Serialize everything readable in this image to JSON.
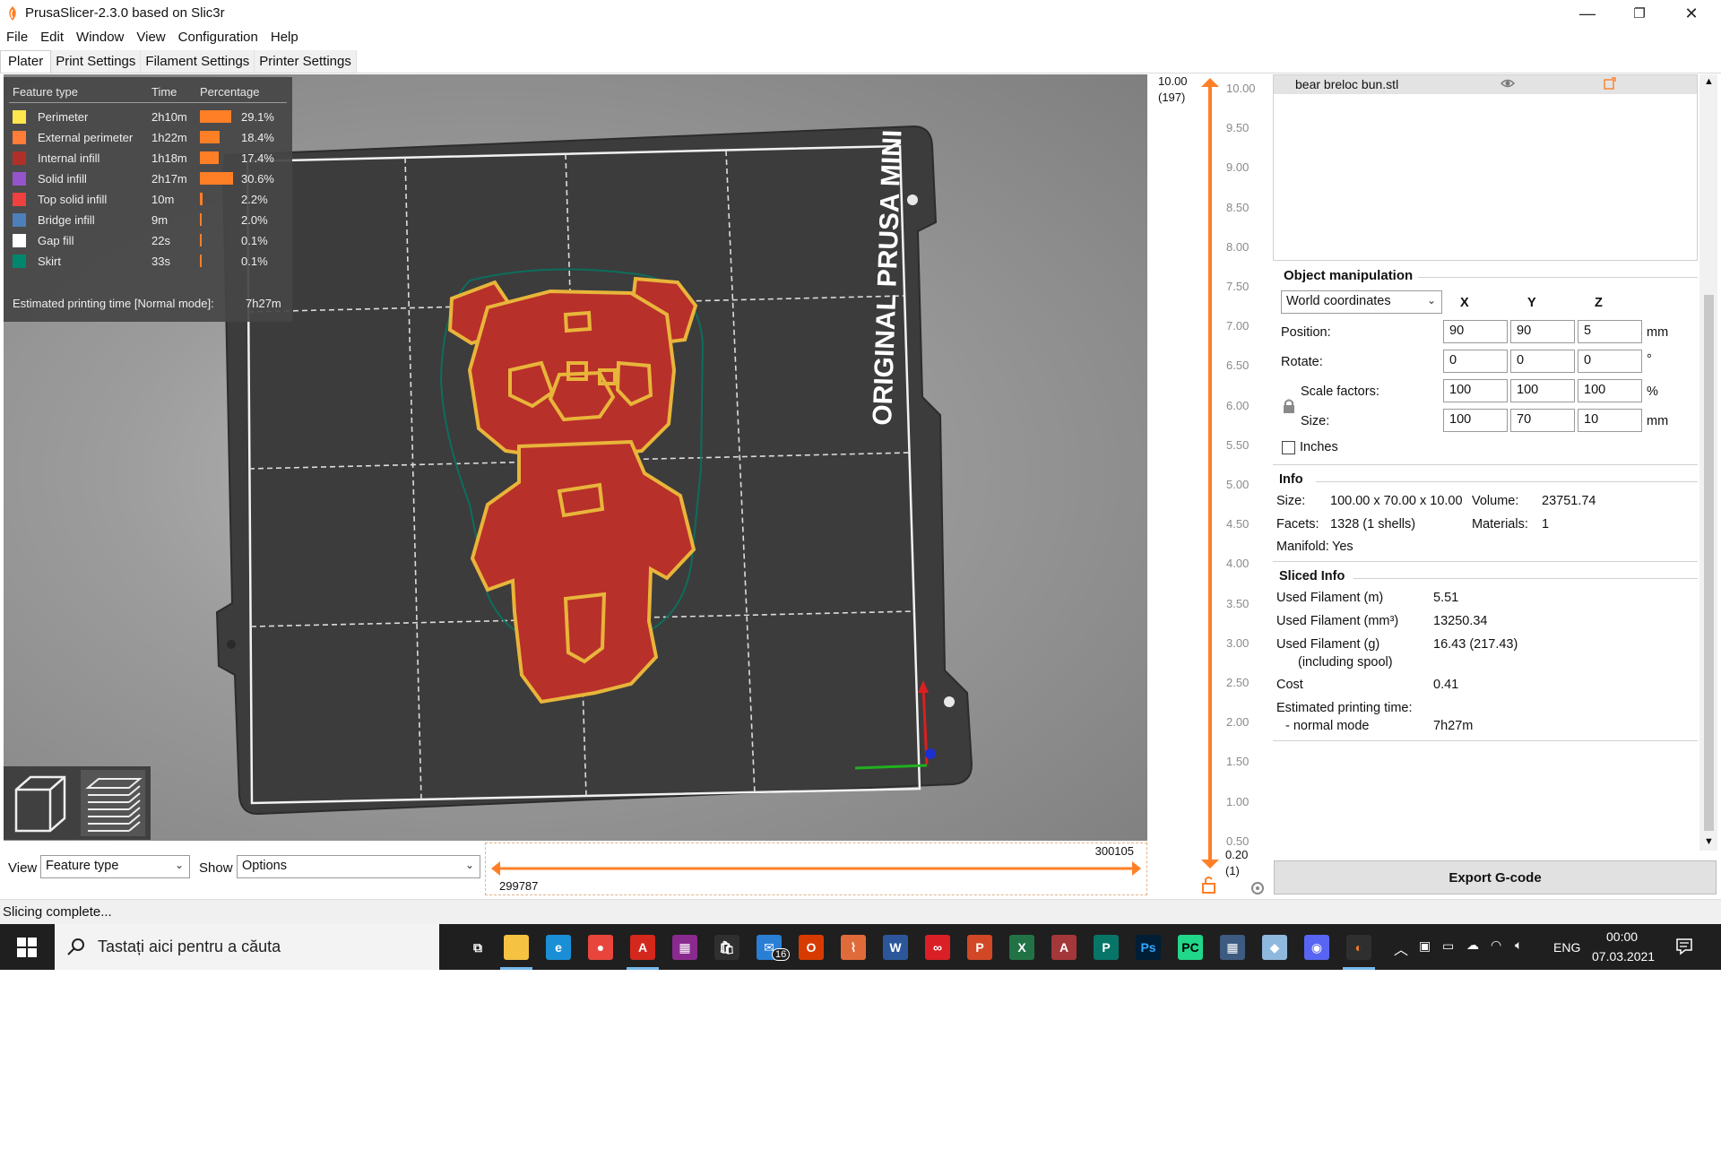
{
  "window": {
    "title": "PrusaSlicer-2.3.0 based on Slic3r",
    "minimize": "—",
    "maximize": "❐",
    "close": "✕"
  },
  "menu": [
    "File",
    "Edit",
    "Window",
    "View",
    "Configuration",
    "Help"
  ],
  "tabs": [
    "Plater",
    "Print Settings",
    "Filament Settings",
    "Printer Settings"
  ],
  "legend": {
    "headers": {
      "type": "Feature type",
      "time": "Time",
      "percentage": "Percentage"
    },
    "rows": [
      {
        "name": "Perimeter",
        "time": "2h10m",
        "pct": "29.1%",
        "value": 29.1,
        "color": "#ffe64d"
      },
      {
        "name": "External perimeter",
        "time": "1h22m",
        "pct": "18.4%",
        "value": 18.4,
        "color": "#ff7d38"
      },
      {
        "name": "Internal infill",
        "time": "1h18m",
        "pct": "17.4%",
        "value": 17.4,
        "color": "#b03029"
      },
      {
        "name": "Solid infill",
        "time": "2h17m",
        "pct": "30.6%",
        "value": 30.6,
        "color": "#9654cc"
      },
      {
        "name": "Top solid infill",
        "time": "10m",
        "pct": "2.2%",
        "value": 2.2,
        "color": "#f04040"
      },
      {
        "name": "Bridge infill",
        "time": "9m",
        "pct": "2.0%",
        "value": 2.0,
        "color": "#4d80ba"
      },
      {
        "name": "Gap fill",
        "time": "22s",
        "pct": "0.1%",
        "value": 0.1,
        "color": "#ffffff"
      },
      {
        "name": "Skirt",
        "time": "33s",
        "pct": "0.1%",
        "value": 0.1,
        "color": "#00876e"
      }
    ],
    "estimated_label": "Estimated printing time [Normal mode]:",
    "estimated_value": "7h27m"
  },
  "bed_label": "ORIGINAL PRUSA MINI",
  "vertical_slider": {
    "top_value": "10.00",
    "top_layer": "(197)",
    "bottom_value": "0.20",
    "bottom_layer": "(1)",
    "ticks": [
      "10.00",
      "9.50",
      "9.00",
      "8.50",
      "8.00",
      "7.50",
      "7.00",
      "6.50",
      "6.00",
      "5.50",
      "5.00",
      "4.50",
      "4.00",
      "3.50",
      "3.00",
      "2.50",
      "2.00",
      "1.50",
      "1.00",
      "0.50"
    ]
  },
  "horizontal_slider": {
    "right_value": "300105",
    "left_value": "299787"
  },
  "bottom": {
    "view_label": "View",
    "view_value": "Feature type",
    "show_label": "Show",
    "show_value": "Options"
  },
  "object_list": {
    "name": "bear breloc bun.stl"
  },
  "object_manipulation": {
    "title": "Object manipulation",
    "coords": "World coordinates",
    "axes": [
      "X",
      "Y",
      "Z"
    ],
    "position": {
      "label": "Position:",
      "values": [
        "90",
        "90",
        "5"
      ],
      "unit": "mm"
    },
    "rotate": {
      "label": "Rotate:",
      "values": [
        "0",
        "0",
        "0"
      ],
      "unit": "°"
    },
    "scale": {
      "label": "Scale factors:",
      "values": [
        "100",
        "100",
        "100"
      ],
      "unit": "%"
    },
    "size": {
      "label": "Size:",
      "values": [
        "100",
        "70",
        "10"
      ],
      "unit": "mm"
    },
    "inches_label": "Inches"
  },
  "info": {
    "title": "Info",
    "size_label": "Size:",
    "size_value": "100.00 x 70.00 x 10.00",
    "volume_label": "Volume:",
    "volume_value": "23751.74",
    "facets_label": "Facets:",
    "facets_value": "1328 (1 shells)",
    "materials_label": "Materials:",
    "materials_value": "1",
    "manifold_label": "Manifold:",
    "manifold_value": "Yes"
  },
  "sliced_info": {
    "title": "Sliced Info",
    "rows": [
      {
        "label": "Used Filament (m)",
        "value": "5.51"
      },
      {
        "label": "Used Filament (mm³)",
        "value": "13250.34"
      },
      {
        "label": "Used Filament (g)",
        "value": "16.43 (217.43)"
      },
      {
        "label": "(including spool)",
        "value": ""
      },
      {
        "label": "Cost",
        "value": "0.41"
      },
      {
        "label": "Estimated printing time:",
        "value": ""
      },
      {
        "label": "- normal mode",
        "value": "7h27m"
      }
    ]
  },
  "export_label": "Export G-code",
  "status": "Slicing complete...",
  "taskbar": {
    "search_placeholder": "Tastați aici pentru a căuta",
    "lang": "ENG",
    "time": "00:00",
    "date": "07.03.2021",
    "mail_badge": "16"
  },
  "colors": {
    "accent": "#ff7f27",
    "model_fill": "#b8302a",
    "perimeter": "#ffe64d",
    "bed": "#3a3a3a"
  }
}
